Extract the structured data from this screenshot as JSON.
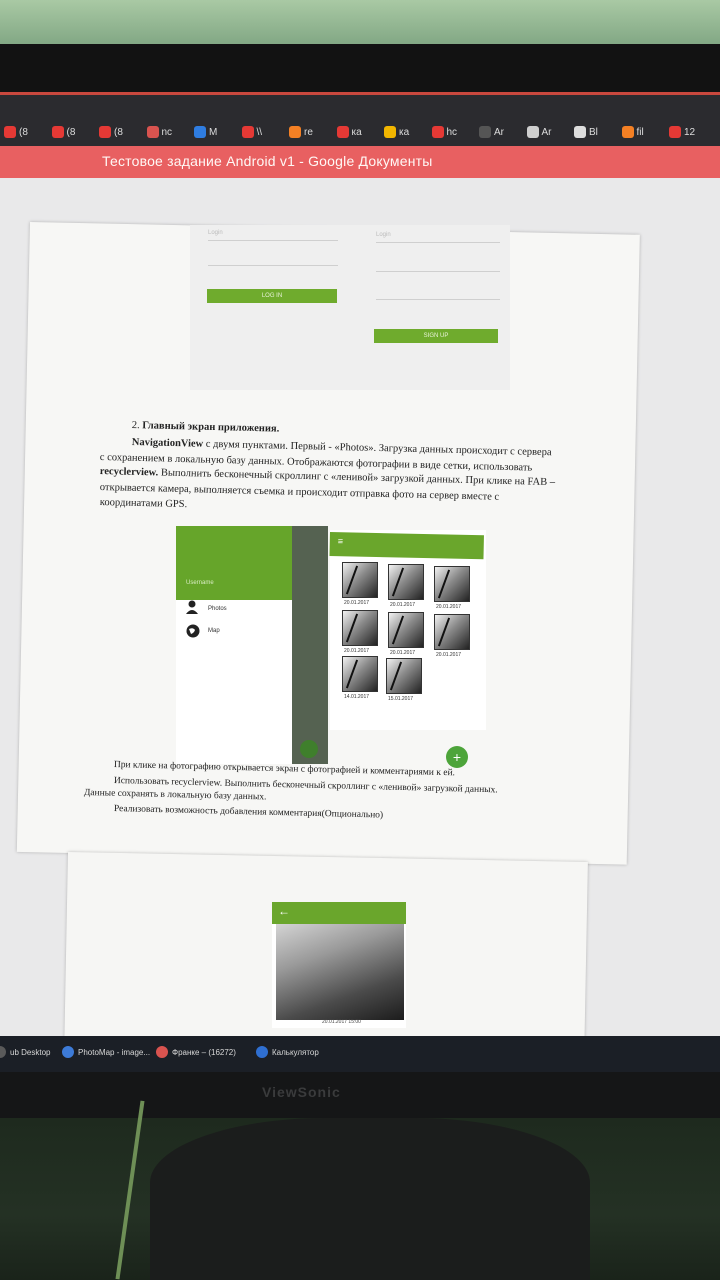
{
  "browser": {
    "tabs": [
      {
        "icon": "yandex-icon",
        "label": "(8",
        "color": "#e53935"
      },
      {
        "icon": "youtube-icon",
        "label": "(8",
        "color": "#e53935"
      },
      {
        "icon": "youtube-icon",
        "label": "(8",
        "color": "#e53935"
      },
      {
        "icon": "app-icon",
        "label": "nc",
        "color": "#d9534f"
      },
      {
        "icon": "messenger-icon",
        "label": "M",
        "color": "#2f7de1"
      },
      {
        "icon": "yandex-icon",
        "label": "\\\\",
        "color": "#e53935"
      },
      {
        "icon": "stack-icon",
        "label": "re",
        "color": "#f48024"
      },
      {
        "icon": "yandex-icon",
        "label": "ка",
        "color": "#e53935"
      },
      {
        "icon": "bookmark-icon",
        "label": "ка",
        "color": "#f2b600"
      },
      {
        "icon": "yandex-icon",
        "label": "hc",
        "color": "#e53935"
      },
      {
        "icon": "dots-icon",
        "label": "Ar",
        "color": "#555"
      },
      {
        "icon": "document-icon",
        "label": "Ar",
        "color": "#cfcfcf"
      },
      {
        "icon": "github-icon",
        "label": "Bl",
        "color": "#ddd"
      },
      {
        "icon": "stack-icon",
        "label": "fil",
        "color": "#f48024"
      },
      {
        "icon": "yandex-icon",
        "label": "12",
        "color": "#e53935"
      }
    ],
    "window_title": "Тестовое задание Android v1 - Google Документы"
  },
  "document": {
    "login_mock": {
      "left_field_label": "Login",
      "right_field_label": "Login",
      "login_button": "LOG IN",
      "signup_button": "SIGN UP"
    },
    "section_heading_num": "2.",
    "section_heading": "Главный экран приложения.",
    "lines": [
      {
        "bold": "NavigationView",
        "text": " с двумя пунктами. Первый - «Photos». Загрузка данных происходит с сервера"
      },
      {
        "bold": "",
        "text": "с сохранением в локальную базу данных. Отображаются фотографии в виде сетки, использовать"
      },
      {
        "bold": "recyclerview.",
        "text": " Выполнить бесконечный скроллинг с «ленивой» загрузкой данных. При клике на FAB –"
      },
      {
        "bold": "",
        "text": "открывается камера, выполняется съемка и происходит отправка фото на сервер вместе с"
      },
      {
        "bold": "",
        "text": "координатами GPS."
      }
    ],
    "drawer_mock": {
      "username": "Username",
      "items": [
        "Photos",
        "Map"
      ]
    },
    "grid_mock": {
      "dates": [
        "20.01.2017",
        "20.01.2017",
        "20.01.2017",
        "20.01.2017",
        "20.01.2017",
        "20.01.2017",
        "14.01.2017",
        "15.01.2017"
      ],
      "fab": "+"
    },
    "lines2": [
      "При клике на фотографию открывается экран с фотографией и комментариями к ей.",
      "Использовать recyclerview. Выполнить бесконечный скроллинг с «ленивой» загрузкой данных.",
      "Данные сохранять в локальную базу данных.",
      "Реализовать возможность добавления комментария(Опционально)"
    ],
    "detail_mock": {
      "back": "←",
      "date": "20.01.2017 15:00"
    }
  },
  "taskbar": {
    "items": [
      {
        "label": "ub Desktop",
        "color": "#5a5a5a"
      },
      {
        "label": "PhotoMap - image...",
        "color": "#3d7bd8"
      },
      {
        "label": "Франке – (16272)",
        "color": "#d9534f"
      },
      {
        "label": "Калькулятор",
        "color": "#2f6fd1"
      }
    ]
  },
  "monitor": {
    "brand": "ViewSonic"
  }
}
